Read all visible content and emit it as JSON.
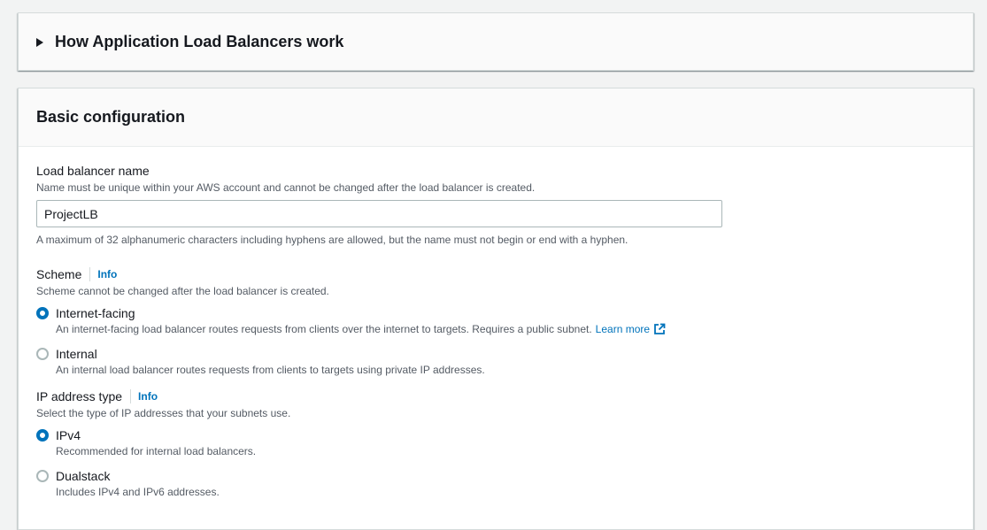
{
  "how_it_works": {
    "title": "How Application Load Balancers work"
  },
  "basic_config": {
    "title": "Basic configuration",
    "lb_name": {
      "label": "Load balancer name",
      "description": "Name must be unique within your AWS account and cannot be changed after the load balancer is created.",
      "value": "ProjectLB",
      "constraint": "A maximum of 32 alphanumeric characters including hyphens are allowed, but the name must not begin or end with a hyphen."
    },
    "scheme": {
      "label": "Scheme",
      "info": "Info",
      "description": "Scheme cannot be changed after the load balancer is created.",
      "options": [
        {
          "label": "Internet-facing",
          "description": "An internet-facing load balancer routes requests from clients over the internet to targets. Requires a public subnet.",
          "link": "Learn more",
          "checked": true
        },
        {
          "label": "Internal",
          "description": "An internal load balancer routes requests from clients to targets using private IP addresses.",
          "checked": false
        }
      ]
    },
    "ip_type": {
      "label": "IP address type",
      "info": "Info",
      "description": "Select the type of IP addresses that your subnets use.",
      "options": [
        {
          "label": "IPv4",
          "description": "Recommended for internal load balancers.",
          "checked": true
        },
        {
          "label": "Dualstack",
          "description": "Includes IPv4 and IPv6 addresses.",
          "checked": false
        }
      ]
    }
  },
  "colors": {
    "accent": "#0073bb",
    "text": "#16191f",
    "secondary_text": "#545b64",
    "background": "#f2f3f3"
  },
  "icons": {
    "expand": "caret-right-icon",
    "external": "external-link-icon"
  }
}
